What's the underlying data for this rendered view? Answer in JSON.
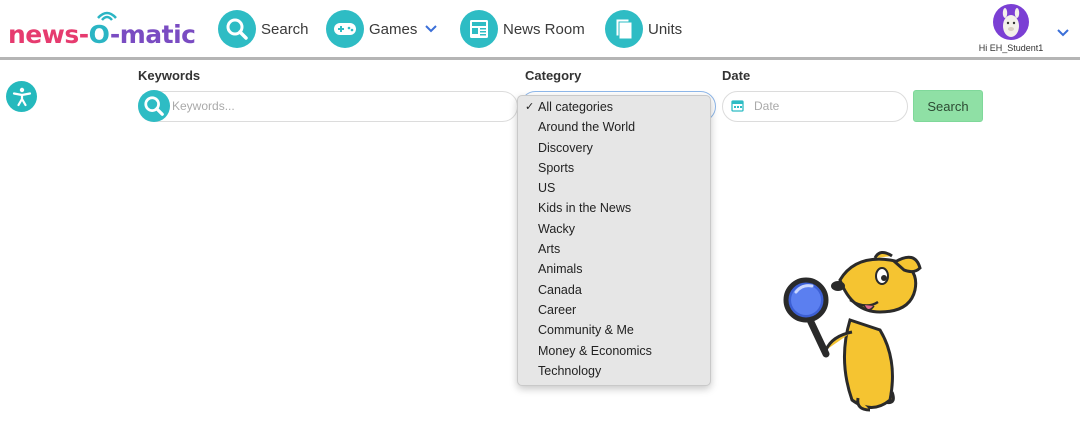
{
  "header": {
    "logo_text": [
      "news-",
      "O",
      "-matic"
    ],
    "nav": [
      {
        "label": "Search",
        "icon": "search-icon"
      },
      {
        "label": "Games",
        "icon": "gamepad-icon",
        "has_chevron": true
      },
      {
        "label": "News Room",
        "icon": "newspaper-icon"
      },
      {
        "label": "Units",
        "icon": "units-icon"
      }
    ],
    "user": {
      "greeting": "Hi EH_Student1"
    }
  },
  "filters": {
    "keywords_label": "Keywords",
    "keywords_placeholder": "Keywords...",
    "category_label": "Category",
    "date_label": "Date",
    "date_placeholder": "Date",
    "search_button": "Search"
  },
  "category_options": [
    {
      "label": "All categories",
      "selected": true
    },
    {
      "label": "Around the World"
    },
    {
      "label": "Discovery"
    },
    {
      "label": "Sports"
    },
    {
      "label": "US"
    },
    {
      "label": "Kids in the News"
    },
    {
      "label": "Wacky"
    },
    {
      "label": "Arts"
    },
    {
      "label": "Animals"
    },
    {
      "label": "Canada"
    },
    {
      "label": "Career"
    },
    {
      "label": "Community & Me"
    },
    {
      "label": "Money & Economics"
    },
    {
      "label": "Technology"
    }
  ],
  "colors": {
    "accent": "#2ebcc4",
    "search_button": "#8fe0a5",
    "avatar": "#7b3fd4"
  }
}
